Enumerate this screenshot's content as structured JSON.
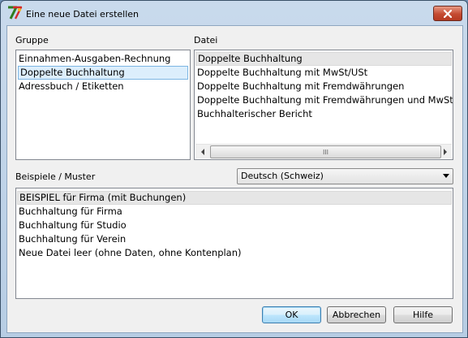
{
  "window": {
    "title": "Eine neue Datei erstellen",
    "close_icon": "close-icon",
    "app_icon": "app-logo-icon"
  },
  "gruppe": {
    "label": "Gruppe",
    "items": [
      "Einnahmen-Ausgaben-Rechnung",
      "Doppelte Buchhaltung",
      "Adressbuch / Etiketten"
    ],
    "selected_index": 1
  },
  "datei": {
    "label": "Datei",
    "items": [
      "Doppelte Buchhaltung",
      "Doppelte Buchhaltung mit MwSt/USt",
      "Doppelte Buchhaltung mit Fremdwährungen",
      "Doppelte Buchhaltung mit Fremdwährungen und MwSt/USt",
      "Buchhalterischer Bericht"
    ],
    "highlighted_index": 0,
    "scroll_grip": "III"
  },
  "beispiele": {
    "label": "Beispiele / Muster",
    "language_value": "Deutsch (Schweiz)",
    "items": [
      "BEISPIEL für Firma (mit Buchungen)",
      "Buchhaltung für Firma",
      "Buchhaltung für Studio",
      "Buchhaltung für Verein",
      "Neue Datei leer (ohne Daten, ohne Kontenplan)"
    ],
    "highlighted_index": 0
  },
  "buttons": {
    "ok": "OK",
    "abbrechen": "Abbrechen",
    "hilfe": "Hilfe"
  },
  "colors": {
    "titlebar": "#c9daec",
    "client_bg": "#f0f0f0",
    "selection_border": "#7db6e3",
    "close_button": "#c44a31"
  }
}
